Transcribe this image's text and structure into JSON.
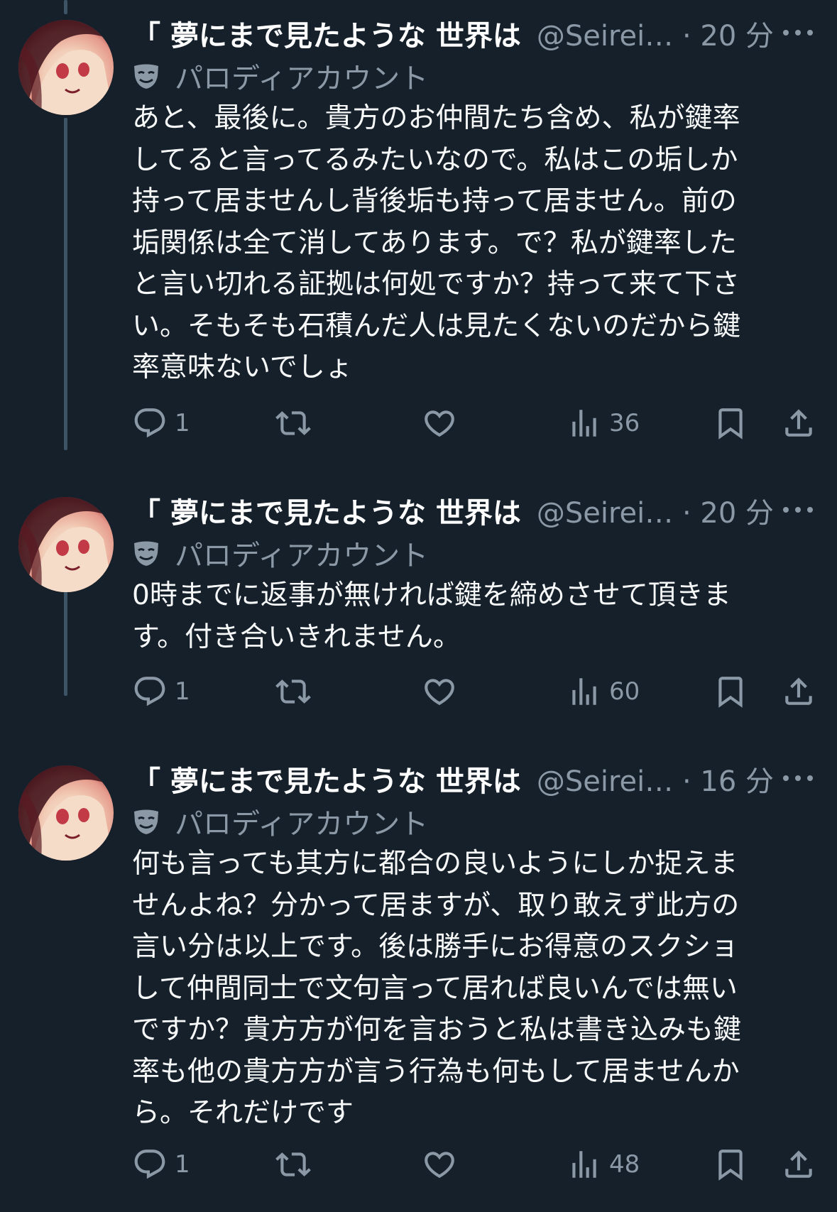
{
  "tweets": [
    {
      "name": "「 夢にまで見たような 世界は",
      "handle_time": "@Seirei… · 20 分",
      "parody_label": "パロディアカウント",
      "text": "あと、最後に。貴方のお仲間たち含め、私が鍵率\nしてると言ってるみたいなので。私はこの垢しか\n持って居ませんし背後垢も持って居ません。前の\n垢関係は全て消してあります。で？私が鍵率した\nと言い切れる証拠は何処ですか？持って来て下さ\nい。そもそも石積んだ人は見たくないのだから鍵\n率意味ないでしょ",
      "replies": "1",
      "views": "36"
    },
    {
      "name": "「 夢にまで見たような 世界は",
      "handle_time": "@Seirei… · 20 分",
      "parody_label": "パロディアカウント",
      "text": "0時までに返事が無ければ鍵を締めさせて頂きま\nす。付き合いきれません。",
      "replies": "1",
      "views": "60"
    },
    {
      "name": "「 夢にまで見たような 世界は",
      "handle_time": "@Seirei… · 16 分",
      "parody_label": "パロディアカウント",
      "text": "何も言っても其方に都合の良いようにしか捉えま\nせんよね？分かって居ますが、取り敢えず此方の\n言い分は以上です。後は勝手にお得意のスクショ\nして仲間同士で文句言って居れば良いんでは無い\nですか？貴方方が何を言おうと私は書き込みも鍵\n率も他の貴方方が言う行為も何もして居ませんか\nら。それだけです",
      "replies": "1",
      "views": "48"
    }
  ],
  "icons": {
    "more": "more-horizontal-icon",
    "parody": "mask-icon",
    "reply": "reply-icon",
    "retweet": "retweet-icon",
    "like": "heart-icon",
    "views": "views-chart-icon",
    "bookmark": "bookmark-icon",
    "share": "share-icon"
  },
  "colors": {
    "background": "#15202b",
    "secondary_text": "#8b98a5",
    "primary_text": "#f7f9f9",
    "thread_line": "#3d5466"
  }
}
